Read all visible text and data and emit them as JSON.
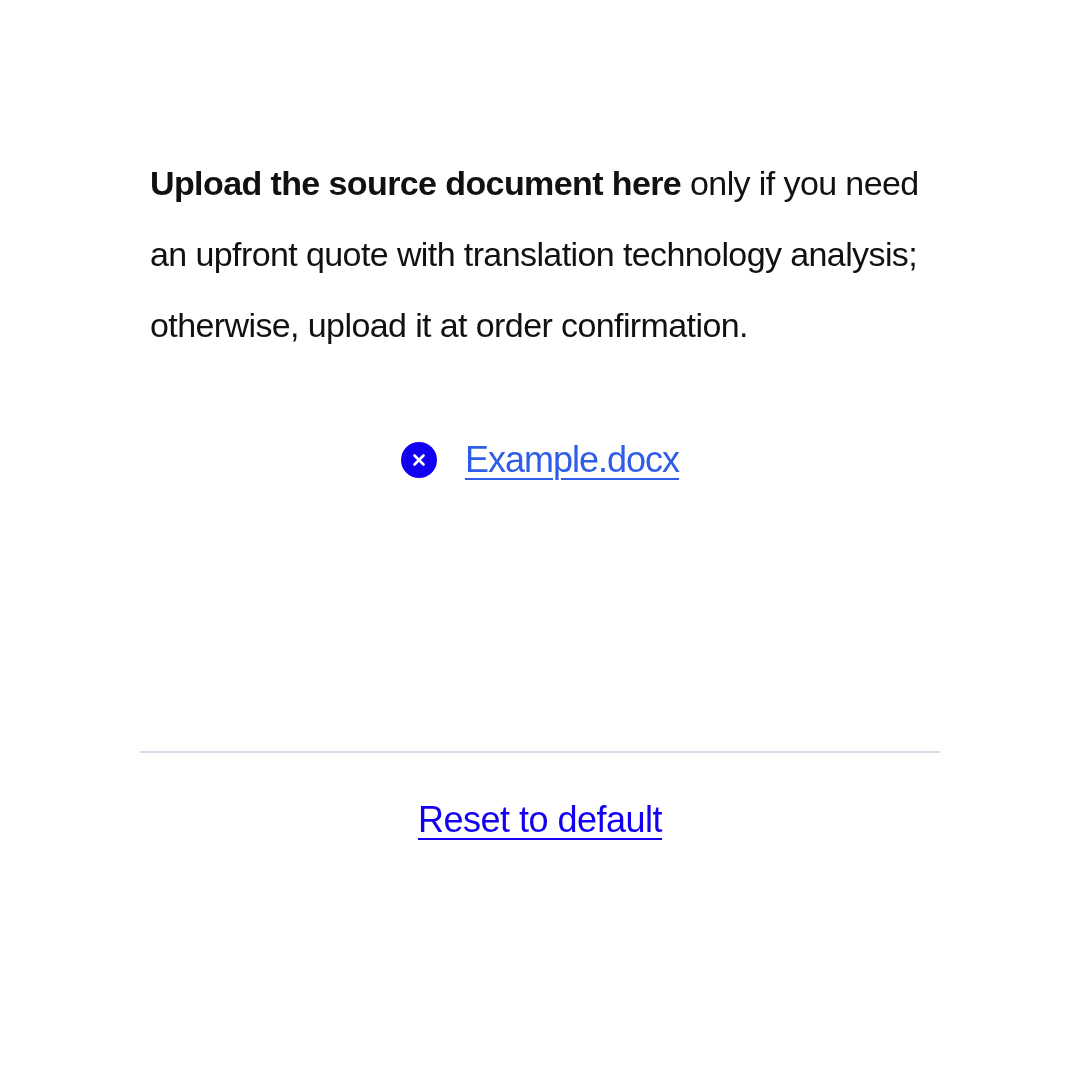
{
  "instructions": "**Upload the source document here** only if you need an upfront quote with translation technology analysis; otherwise, upload it at order confirmation.",
  "attachment": {
    "file_name": "Example.docx"
  },
  "reset_link": "Reset to default"
}
